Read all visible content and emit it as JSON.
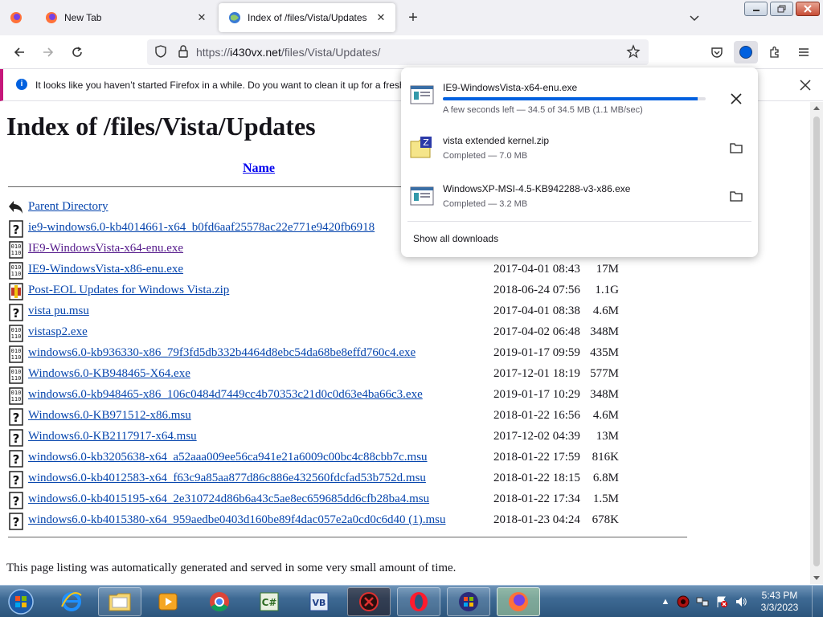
{
  "browser": {
    "tabs": [
      {
        "title": "New Tab",
        "active": false
      },
      {
        "title": "Index of /files/Vista/Updates",
        "active": true
      }
    ],
    "url_prefix": "https://",
    "url_host": "i430vx.net",
    "url_path": "/files/Vista/Updates/",
    "notification": "It looks like you haven’t started Firefox in a while. Do you want to clean it up for a fresh"
  },
  "page": {
    "heading": "Index of /files/Vista/Updates",
    "column_name": "Name",
    "parent_label": "Parent Directory",
    "files": [
      {
        "name": "ie9-windows6.0-kb4014661-x64_b0fd6aaf25578ac22e771e9420fb6918",
        "date": "",
        "size": "",
        "icon": "unknown-file-icon",
        "visited": false
      },
      {
        "name": "IE9-WindowsVista-x64-enu.exe",
        "date": "",
        "size": "",
        "icon": "binary-file-icon",
        "visited": true
      },
      {
        "name": "IE9-WindowsVista-x86-enu.exe",
        "date": "2017-04-01 08:43",
        "size": "17M",
        "icon": "binary-file-icon",
        "visited": false
      },
      {
        "name": "Post-EOL Updates for Windows Vista.zip",
        "date": "2018-06-24 07:56",
        "size": "1.1G",
        "icon": "archive-file-icon",
        "visited": false
      },
      {
        "name": "vista pu.msu",
        "date": "2017-04-01 08:38",
        "size": "4.6M",
        "icon": "unknown-file-icon",
        "visited": false
      },
      {
        "name": "vistasp2.exe",
        "date": "2017-04-02 06:48",
        "size": "348M",
        "icon": "binary-file-icon",
        "visited": false
      },
      {
        "name": "windows6.0-kb936330-x86_79f3fd5db332b4464d8ebc54da68be8effd760c4.exe",
        "date": "2019-01-17 09:59",
        "size": "435M",
        "icon": "binary-file-icon",
        "visited": false
      },
      {
        "name": "Windows6.0-KB948465-X64.exe",
        "date": "2017-12-01 18:19",
        "size": "577M",
        "icon": "binary-file-icon",
        "visited": false
      },
      {
        "name": "windows6.0-kb948465-x86_106c0484d7449cc4b70353c21d0c0d63e4ba66c3.exe",
        "date": "2019-01-17 10:29",
        "size": "348M",
        "icon": "binary-file-icon",
        "visited": false
      },
      {
        "name": "Windows6.0-KB971512-x86.msu",
        "date": "2018-01-22 16:56",
        "size": "4.6M",
        "icon": "unknown-file-icon",
        "visited": false
      },
      {
        "name": "Windows6.0-KB2117917-x64.msu",
        "date": "2017-12-02 04:39",
        "size": "13M",
        "icon": "unknown-file-icon",
        "visited": false
      },
      {
        "name": "windows6.0-kb3205638-x64_a52aaa009ee56ca941e21a6009c00bc4c88cbb7c.msu",
        "date": "2018-01-22 17:59",
        "size": "816K",
        "icon": "unknown-file-icon",
        "visited": false
      },
      {
        "name": "windows6.0-kb4012583-x64_f63c9a85aa877d86c886e432560fdcfad53b752d.msu",
        "date": "2018-01-22 18:15",
        "size": "6.8M",
        "icon": "unknown-file-icon",
        "visited": false
      },
      {
        "name": "windows6.0-kb4015195-x64_2e310724d86b6a43c5ae8ec659685dd6cfb28ba4.msu",
        "date": "2018-01-22 17:34",
        "size": "1.5M",
        "icon": "unknown-file-icon",
        "visited": false
      },
      {
        "name": "windows6.0-kb4015380-x64_959aedbe0403d160be89f4dac057e2a0cd0c6d40 (1).msu",
        "date": "2018-01-23 04:24",
        "size": "678K",
        "icon": "unknown-file-icon",
        "visited": false
      }
    ],
    "footer": "This page listing was automatically generated and served in some very small amount of time."
  },
  "downloads": {
    "items": [
      {
        "name": "IE9-WindowsVista-x64-enu.exe",
        "status": "A few seconds left — 34.5 of 34.5 MB (1.1 MB/sec)",
        "progress": 0.97,
        "icon": "exe-file-icon",
        "action": "cancel-icon"
      },
      {
        "name": "vista extended kernel.zip",
        "status": "Completed — 7.0 MB",
        "icon": "zip-file-icon",
        "action": "folder-icon"
      },
      {
        "name": "WindowsXP-MSI-4.5-KB942288-v3-x86.exe",
        "status": "Completed — 3.2 MB",
        "icon": "exe-file-icon",
        "action": "folder-icon"
      }
    ],
    "show_all": "Show all downloads"
  },
  "taskbar": {
    "apps": [
      "start-orb-icon",
      "internet-explorer-icon",
      "file-explorer-icon",
      "media-player-icon",
      "chrome-icon",
      "csharp-icon",
      "vb-icon",
      "tool-icon",
      "opera-icon",
      "setup-icon",
      "firefox-icon"
    ],
    "time": "5:43 PM",
    "date": "3/3/2023"
  },
  "colors": {
    "accent": "#0060df",
    "link": "#0645ad",
    "visited": "#551a8b",
    "notification_stripe": "#c6177a"
  }
}
